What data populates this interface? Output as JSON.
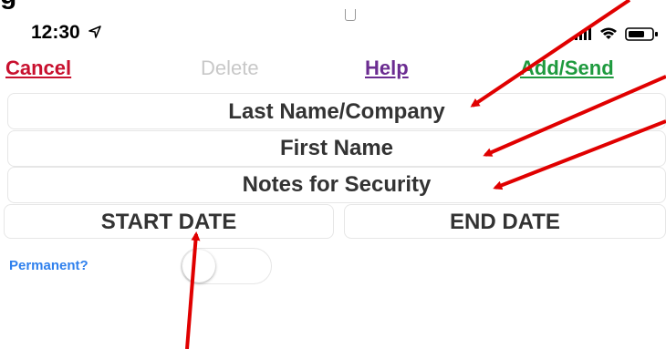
{
  "clipped_heading": "g                                     ",
  "status_bar": {
    "time": "12:30",
    "icons": [
      "location-arrow-icon",
      "signal-icon",
      "wifi-icon",
      "battery-icon"
    ]
  },
  "toolbar": {
    "cancel_label": "Cancel",
    "delete_label": "Delete",
    "help_label": "Help",
    "add_send_label": "Add/Send"
  },
  "form": {
    "last_name_placeholder": "Last Name/Company",
    "first_name_placeholder": "First Name",
    "notes_placeholder": "Notes for Security",
    "start_date_placeholder": "START DATE",
    "end_date_placeholder": "END DATE",
    "permanent_label": "Permanent?",
    "permanent_on": false
  },
  "colors": {
    "cancel": "#c8102e",
    "delete_disabled": "#c8c8c8",
    "help": "#6b2c91",
    "add_send": "#1e9a3e",
    "permanent_label": "#2f80ed",
    "annotation_arrow": "#e00000"
  }
}
